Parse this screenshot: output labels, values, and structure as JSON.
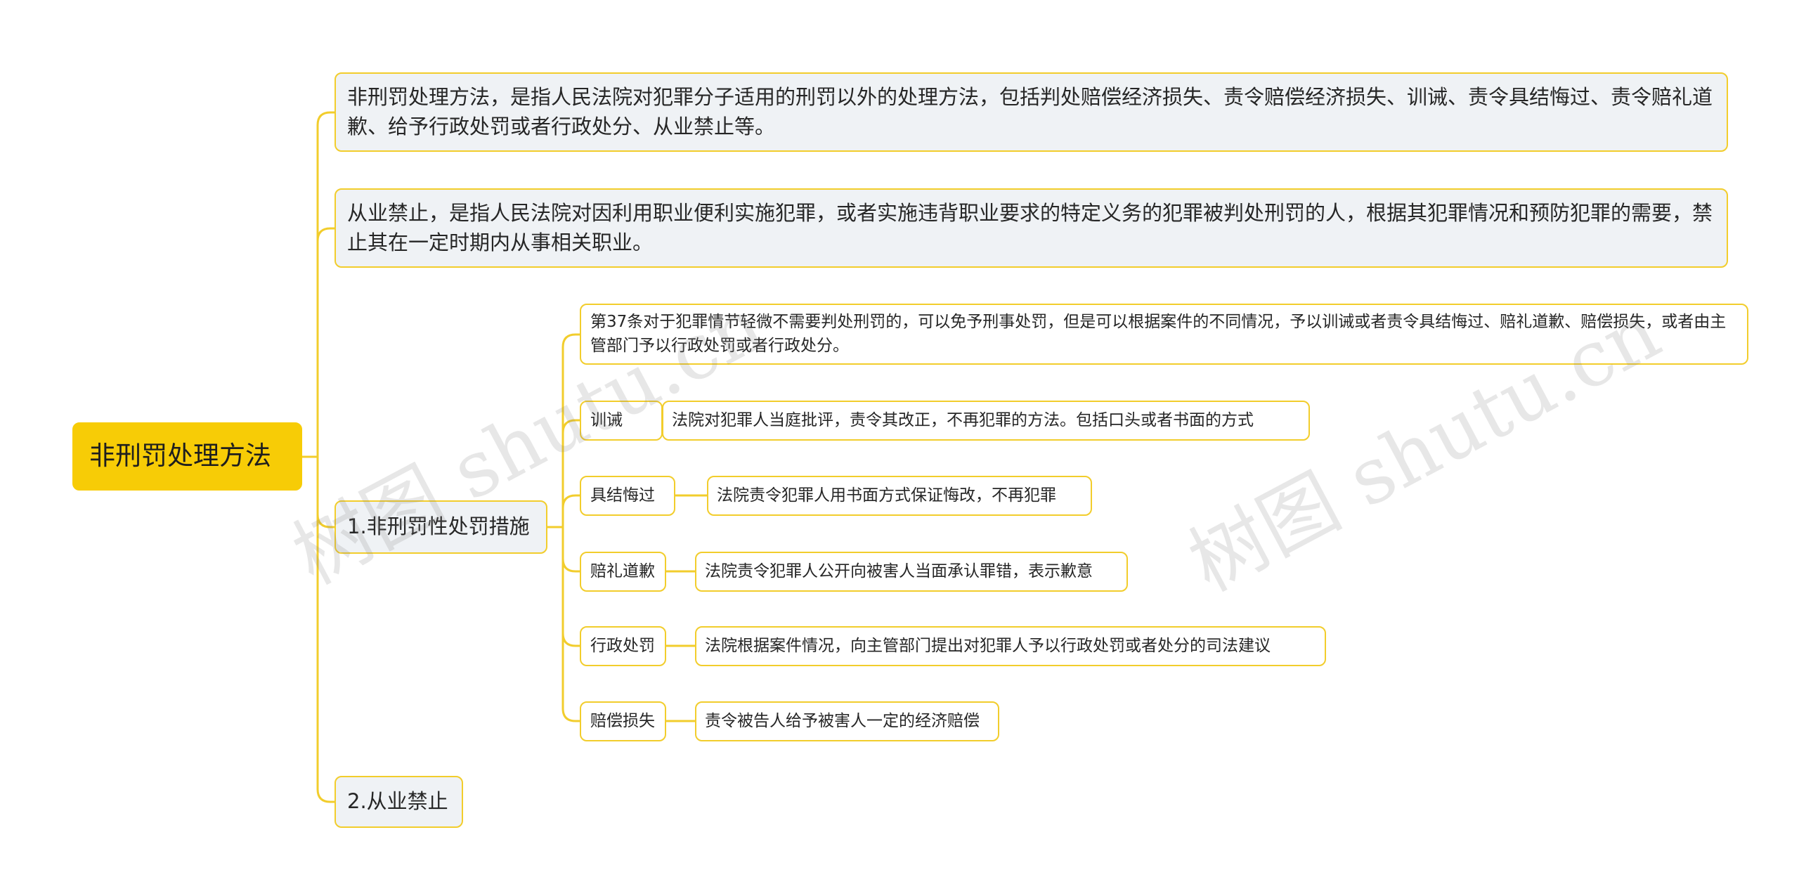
{
  "mindmap": {
    "root": {
      "label": "非刑罚处理方法"
    },
    "level1": [
      {
        "label": "非刑罚处理方法，是指人民法院对犯罪分子适用的刑罚以外的处理方法，包括判处赔偿经济损失、责令赔偿经济损失、训诫、责令具结悔过、责令赔礼道歉、给予行政处罚或者行政处分、从业禁止等。"
      },
      {
        "label": "从业禁止，是指人民法院对因利用职业便利实施犯罪，或者实施违背职业要求的特定义务的犯罪被判处刑罚的人，根据其犯罪情况和预防犯罪的需要，禁止其在一定时期内从事相关职业。"
      },
      {
        "label": "1.非刑罚性处罚措施"
      },
      {
        "label": "2.从业禁止"
      }
    ],
    "measures": [
      {
        "label": "第37条对于犯罪情节轻微不需要判处刑罚的，可以免予刑事处罚，但是可以根据案件的不同情况，予以训诫或者责令具结悔过、赔礼道歉、赔偿损失，或者由主管部门予以行政处罚或者行政处分。"
      },
      {
        "label": "训诫",
        "detail": "法院对犯罪人当庭批评，责令其改正，不再犯罪的方法。包括口头或者书面的方式"
      },
      {
        "label": "具结悔过",
        "detail": "法院责令犯罪人用书面方式保证悔改，不再犯罪"
      },
      {
        "label": "赔礼道歉",
        "detail": "法院责令犯罪人公开向被害人当面承认罪错，表示歉意"
      },
      {
        "label": "行政处罚",
        "detail": "法院根据案件情况，向主管部门提出对犯罪人予以行政处罚或者处分的司法建议"
      },
      {
        "label": "赔偿损失",
        "detail": "责令被告人给予被害人一定的经济赔偿"
      }
    ]
  },
  "watermark": {
    "text1": "树图 shutu.cn",
    "text2": "树图 shutu.cn"
  },
  "colors": {
    "root_fill": "#f7cc06",
    "border": "#f2cd2c",
    "connector": "#f2cd2c",
    "level1_fill": "#eff2f5",
    "text": "#262626"
  }
}
